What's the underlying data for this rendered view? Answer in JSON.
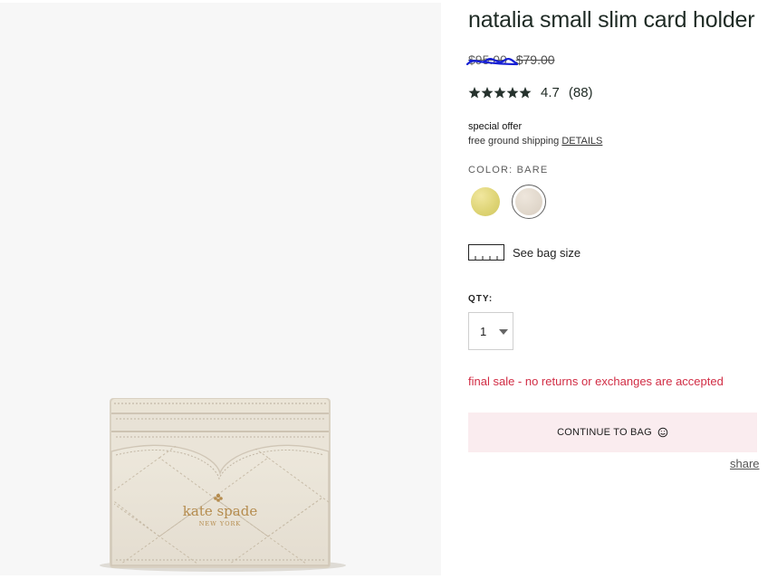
{
  "product": {
    "title": "natalia small slim card holder",
    "original_price": "$95.00",
    "sale_price": "$79.00",
    "rating_value": 4.7,
    "rating_text": "4.7",
    "review_count": "(88)"
  },
  "offer": {
    "heading": "special offer",
    "text": "free ground shipping ",
    "link_label": "DETAILS"
  },
  "color": {
    "label": "COLOR: BARE",
    "options": [
      "yellow",
      "bare"
    ],
    "selected": "bare"
  },
  "bag_size": {
    "label": "See bag size",
    "icon": "ruler-icon"
  },
  "quantity": {
    "label": "QTY:",
    "value": "1"
  },
  "notice": {
    "final_sale": "final sale - no returns or exchanges are accepted"
  },
  "actions": {
    "continue_label": "CONTINUE TO BAG",
    "continue_icon": "smile-icon",
    "share_label": "share"
  },
  "image": {
    "brand_logo": "kate spade",
    "brand_sub": "NEW YORK"
  },
  "colors": {
    "title": "#1f2b25",
    "alert": "#d12d45",
    "button_bg": "#faecef",
    "scribble": "#1720d4"
  }
}
